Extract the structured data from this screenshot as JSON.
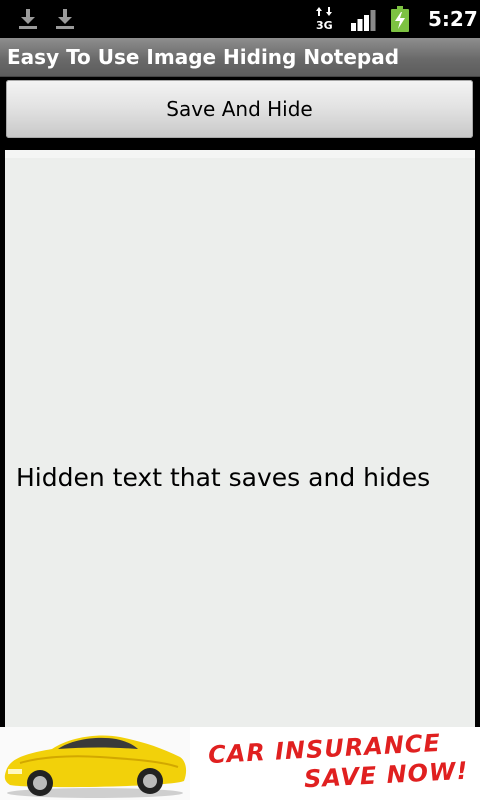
{
  "status_bar": {
    "time": "5:27",
    "network_label": "3G",
    "icons": [
      "download-icon",
      "download-icon",
      "network-3g-icon",
      "signal-icon",
      "battery-charging-icon"
    ],
    "battery_color": "#7dc242"
  },
  "title_bar": {
    "title": "Easy To Use Image Hiding Notepad"
  },
  "toolbar": {
    "save_label": "Save And Hide"
  },
  "editor": {
    "text": "Hidden text that saves and hides"
  },
  "ad": {
    "line1": "CAR INSURANCE",
    "line2": "SAVE NOW!",
    "image": "yellow-sports-car",
    "accent_color": "#e02020"
  }
}
